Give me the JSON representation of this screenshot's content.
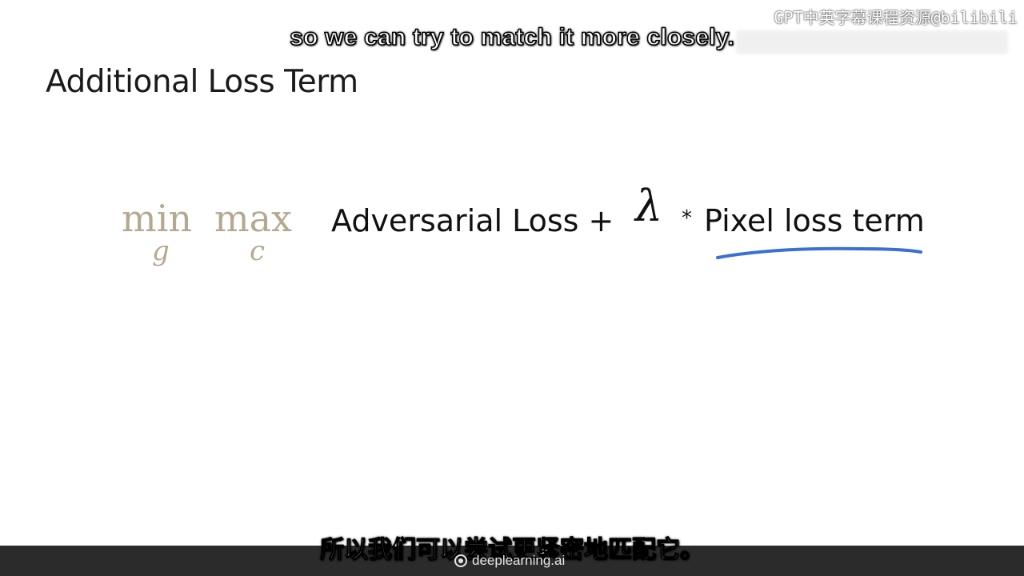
{
  "overlay": {
    "watermark": "GPT中英字幕课程资源@bilibili",
    "subtitle_en": "so we can try to match it more closely.",
    "subtitle_zh": "所以我们可以尝试更紧密地匹配它。"
  },
  "slide": {
    "title": "Additional Loss Term",
    "formula": {
      "min_op": "min",
      "min_sub": "g",
      "max_op": "max",
      "max_sub": "c",
      "adversarial_term": "Adversarial Loss +",
      "lambda": "λ",
      "multiply": "*",
      "pixel_term": "Pixel loss term"
    },
    "underline_color": "#3b6fd6"
  },
  "footer": {
    "brand": "deeplearning.ai"
  }
}
